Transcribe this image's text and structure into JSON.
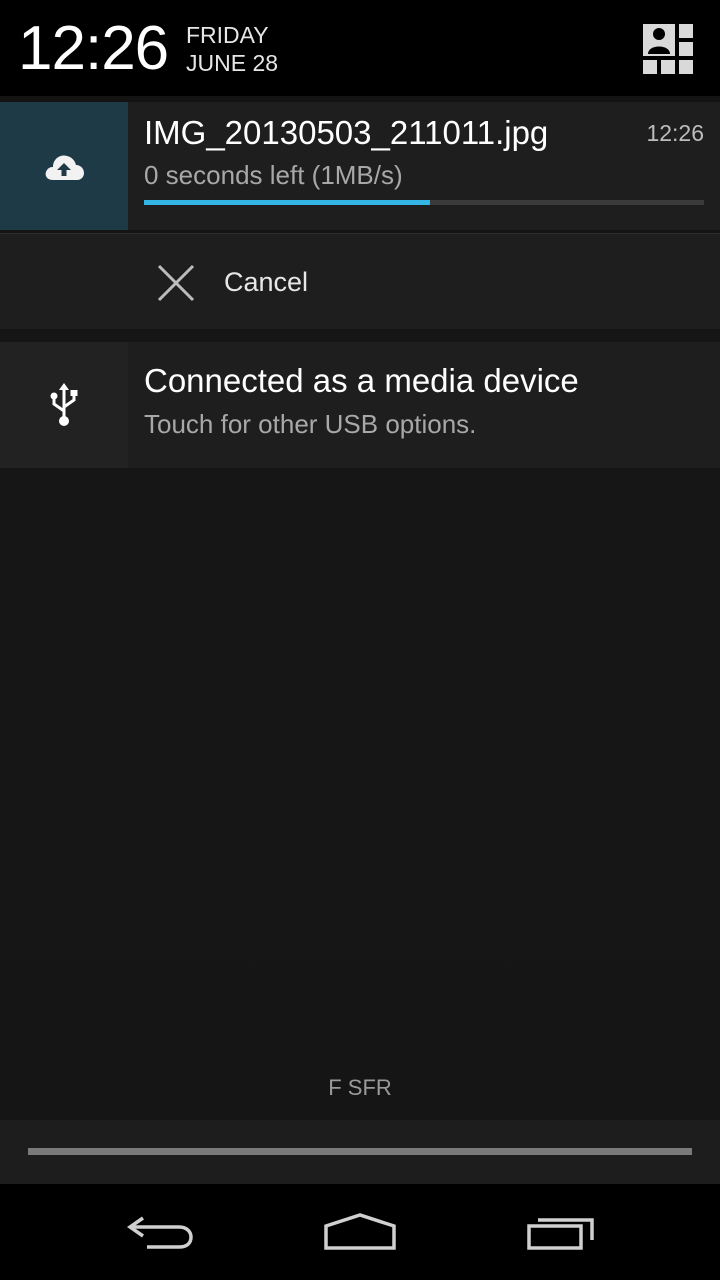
{
  "header": {
    "time": "12:26",
    "day": "FRIDAY",
    "date": "JUNE 28",
    "quick_settings_icon": "user-grid-icon"
  },
  "notifications": [
    {
      "icon": "cloud-upload-icon",
      "title": "IMG_20130503_211011.jpg",
      "text": "0 seconds left (1MB/s)",
      "time": "12:26",
      "progress_percent": 51,
      "action": {
        "icon": "close-icon",
        "label": "Cancel"
      }
    },
    {
      "icon": "usb-icon",
      "title": "Connected as a media device",
      "text": "Touch for other USB options."
    }
  ],
  "carrier": "F SFR",
  "colors": {
    "accent": "#33b5e5",
    "upload_icon_bg": "#1f3a47",
    "notification_bg": "#1e1e1e"
  },
  "navbar": {
    "back_icon": "back-icon",
    "home_icon": "home-icon",
    "recents_icon": "recents-icon"
  }
}
